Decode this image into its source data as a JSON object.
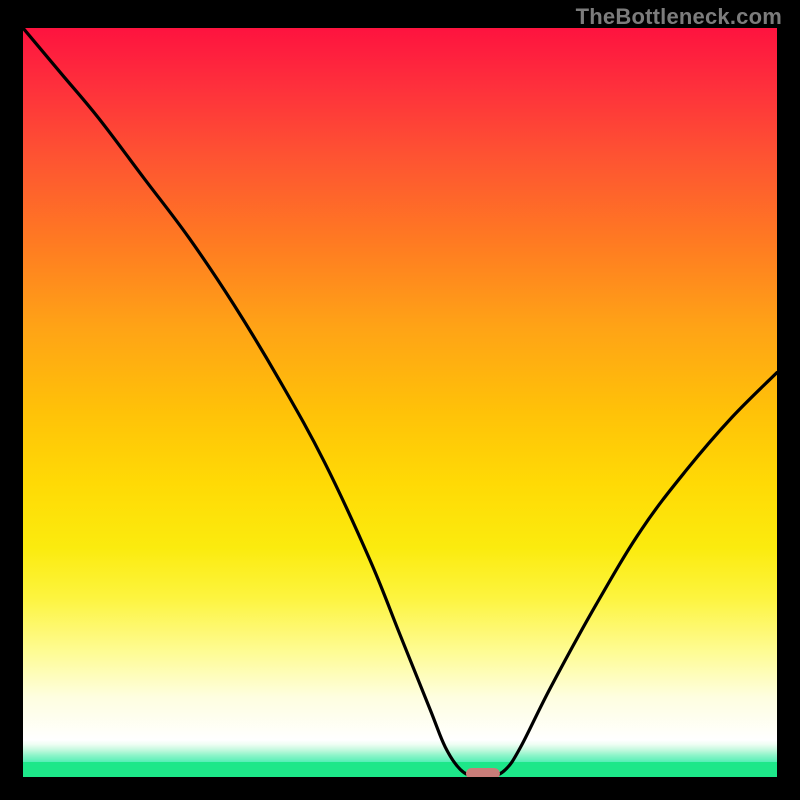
{
  "watermark": "TheBottleneck.com",
  "colors": {
    "background": "#000000",
    "curve_stroke": "#000000",
    "marker_fill": "#c97d79",
    "green_strip": "#1de789",
    "gradient_top": "#fe133f",
    "gradient_bottom": "#ffffff"
  },
  "chart_data": {
    "type": "line",
    "title": "",
    "xlabel": "",
    "ylabel": "",
    "x_range": [
      0,
      100
    ],
    "y_range": [
      0,
      100
    ],
    "series": [
      {
        "name": "bottleneck-curve",
        "x": [
          0,
          5,
          10,
          16,
          22,
          28,
          34,
          40,
          46,
          50,
          54,
          56,
          58,
          60,
          62,
          64,
          66,
          70,
          76,
          82,
          88,
          94,
          100
        ],
        "values": [
          100,
          94,
          88,
          80,
          72,
          63,
          53,
          42,
          29,
          19,
          9,
          4,
          1,
          0,
          0,
          1,
          4,
          12,
          23,
          33,
          41,
          48,
          54
        ]
      }
    ],
    "marker": {
      "x": 61,
      "y": 0,
      "width_frac": 0.045,
      "height_frac": 0.015
    },
    "background_gradient": {
      "direction": "vertical",
      "stops": [
        {
          "pos": 0.0,
          "color": "#fe133f"
        },
        {
          "pos": 0.3,
          "color": "#ff7a22"
        },
        {
          "pos": 0.6,
          "color": "#ffda05"
        },
        {
          "pos": 0.88,
          "color": "#fefc98"
        },
        {
          "pos": 0.95,
          "color": "#ffffff"
        },
        {
          "pos": 0.98,
          "color": "#8cf4c9"
        },
        {
          "pos": 1.0,
          "color": "#1de789"
        }
      ]
    }
  }
}
